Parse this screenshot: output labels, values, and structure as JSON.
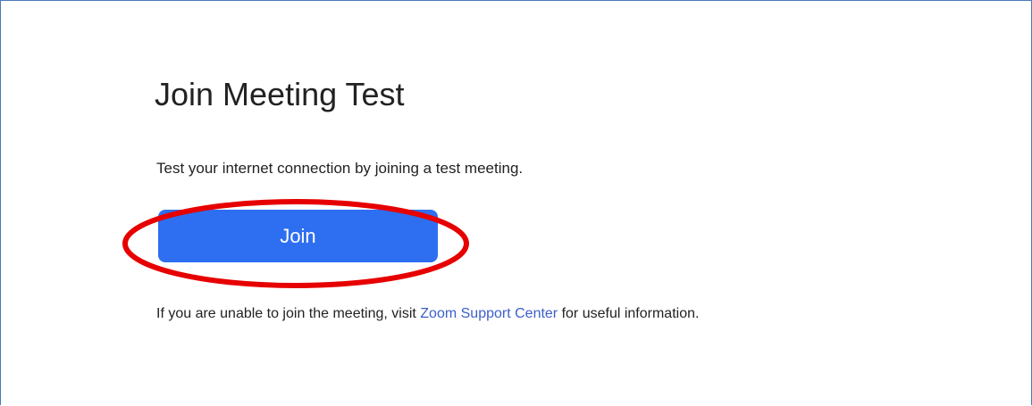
{
  "page": {
    "title": "Join Meeting Test",
    "description": "Test your internet connection by joining a test meeting.",
    "join_button_label": "Join",
    "help": {
      "prefix": "If you are unable to join the meeting, visit ",
      "link_text": "Zoom Support Center",
      "suffix": " for useful information."
    }
  },
  "colors": {
    "button_background": "#2d6ff0",
    "link": "#3c5fc9",
    "annotation": "#e60000",
    "frame_border": "#4a7ab8"
  }
}
